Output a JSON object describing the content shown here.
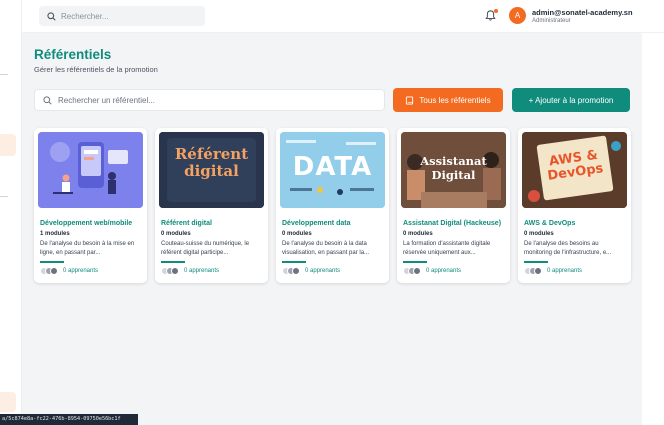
{
  "header": {
    "search_placeholder": "Rechercher...",
    "user_email": "admin@sonatel-academy.sn",
    "user_role": "Administrateur",
    "avatar_initial": "A"
  },
  "page": {
    "title": "Référentiels",
    "subtitle": "Gérer les référentiels de la promotion",
    "search_placeholder": "Rechercher un référentiel...",
    "all_button": "Tous les référentiels",
    "add_button": "+ Ajouter à la promotion"
  },
  "cards": [
    {
      "name": "Développement web/mobile",
      "modules": "1 modules",
      "desc": "De l'analyse du besoin à la mise en ligne, en passant par...",
      "learners": "0 apprenants"
    },
    {
      "name": "Référent digital",
      "modules": "0 modules",
      "desc": "Couteau-suisse du numérique, le référent digital participe...",
      "learners": "0 apprenants",
      "image_text": "Référent digital"
    },
    {
      "name": "Développement data",
      "modules": "0 modules",
      "desc": "De l'analyse du besoin à la data visualisation, en passant par la...",
      "learners": "0 apprenants",
      "image_text": "DATA"
    },
    {
      "name": "Assistanat Digital (Hackeuse)",
      "modules": "0 modules",
      "desc": "La formation d'assistante digitale réservée uniquement aux...",
      "learners": "0 apprenants",
      "image_text": "Assistanat Digital"
    },
    {
      "name": "AWS & DevOps",
      "modules": "0 modules",
      "desc": "De l'analyse des besoins au monitoring de l'infrastructure, e...",
      "learners": "0 apprenants",
      "image_text": "AWS & DevOps"
    }
  ],
  "footer": {
    "id_text": "a/5c874e8a-fc22-476b-8954-09750e56bc1f"
  },
  "colors": {
    "accent": "#0f8c7c",
    "orange": "#f26b21"
  }
}
